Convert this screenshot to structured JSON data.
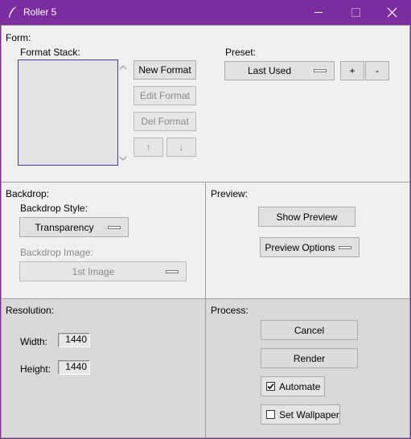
{
  "window": {
    "title": "Roller 5",
    "app_icon": "feather-icon",
    "controls": {
      "minimize": "minimize-icon",
      "maximize": "maximize-icon",
      "close": "close-icon"
    }
  },
  "form": {
    "heading": "Form:",
    "format_stack_label": "Format Stack:",
    "format_stack_items": [],
    "buttons": {
      "new_format": "New Format",
      "edit_format": "Edit Format",
      "del_format": "Del Format",
      "up": "↑",
      "down": "↓"
    },
    "preset_label": "Preset:",
    "preset_value": "Last Used",
    "preset_add": "+",
    "preset_remove": "-"
  },
  "backdrop": {
    "heading": "Backdrop:",
    "style_label": "Backdrop Style:",
    "style_value": "Transparency",
    "image_label": "Backdrop Image:",
    "image_value": "1st Image"
  },
  "preview": {
    "heading": "Preview:",
    "show_preview": "Show Preview",
    "preview_options": "Preview Options"
  },
  "resolution": {
    "heading": "Resolution:",
    "width_label": "Width:",
    "width_value": "1440",
    "height_label": "Height:",
    "height_value": "1440"
  },
  "process": {
    "heading": "Process:",
    "cancel": "Cancel",
    "render": "Render",
    "automate_label": "Automate",
    "automate_checked": true,
    "set_wallpaper_label": "Set Wallpaper",
    "set_wallpaper_checked": false
  },
  "colors": {
    "titlebar": "#7b2c9e",
    "window_bg": "#f0f0f0",
    "lower_panel_bg": "#d9d9d9"
  }
}
